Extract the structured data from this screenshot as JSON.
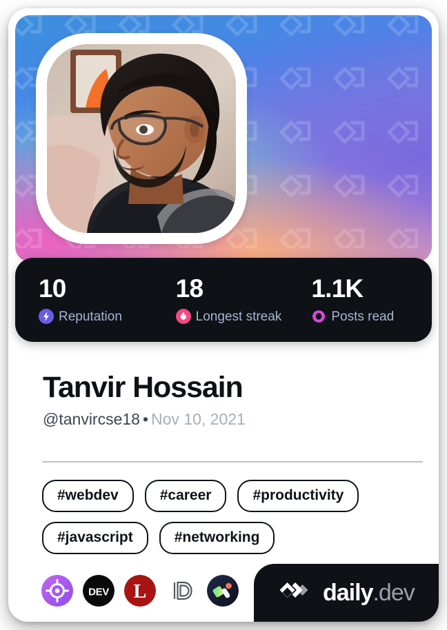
{
  "card": {
    "type": "devcard",
    "background_color": "#ffffff"
  },
  "cover": {
    "watermark_icon": "daily-dev-logo-pattern",
    "gradient_colors": [
      "#3b8fdd",
      "#4a86e8",
      "#76d8c8",
      "#8f86e0",
      "#ee60be",
      "#fab078"
    ]
  },
  "avatar": {
    "icon": "user-avatar-photo",
    "alt": "Profile photo of Tanvir Hossain"
  },
  "stats": [
    {
      "value": "10",
      "label": "Reputation",
      "icon": "reputation-bolt-icon",
      "color": "#6b5ce7"
    },
    {
      "value": "18",
      "label": "Longest streak",
      "icon": "streak-flame-icon",
      "color": "#f5487f"
    },
    {
      "value": "1.1K",
      "label": "Posts read",
      "icon": "posts-read-eye-icon",
      "color": "#d648d6"
    }
  ],
  "profile": {
    "name": "Tanvir Hossain",
    "handle": "@tanvircse18",
    "separator": "•",
    "joined": "Nov 10, 2021"
  },
  "tags": [
    "#webdev",
    "#career",
    "#productivity",
    "#javascript",
    "#networking"
  ],
  "source_badges": [
    {
      "name": "target-purple-badge",
      "label": ""
    },
    {
      "name": "dev-to-badge",
      "label": "DEV"
    },
    {
      "name": "lobsters-badge",
      "label": "L"
    },
    {
      "name": "daily-d-outline-badge",
      "label": "D"
    },
    {
      "name": "colorful-dark-badge",
      "label": ""
    }
  ],
  "brand": {
    "mark_icon": "daily-dev-logo-mark",
    "primary": "daily",
    "secondary": ".dev",
    "background_color": "#0e1217"
  }
}
